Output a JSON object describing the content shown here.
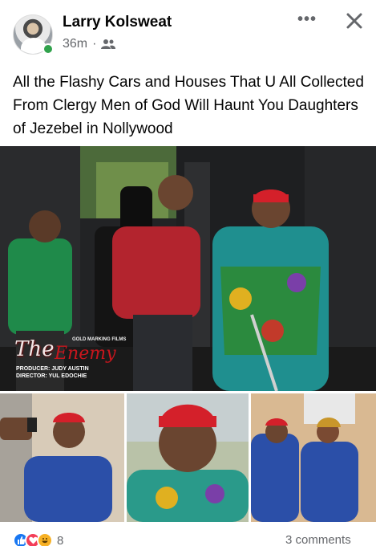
{
  "post": {
    "author": "Larry Kolsweat",
    "time": "36m",
    "separator": "·",
    "privacy_icon": "friends-icon",
    "more_icon": "more-options-icon",
    "more_glyph": "•••",
    "close_icon": "close-icon",
    "text": "All the Flashy Cars and Houses That U All Collected From Clergy Men of God Will Haunt You Daughters of Jezebel in Nollywood"
  },
  "media": {
    "watermark": {
      "title": "The",
      "title_accent": "Enemy",
      "studio": "GOLD MARKING FILMS",
      "producer": "PRODUCER: JUDY AUSTIN",
      "director": "DIRECTOR: YUL EDOCHIE"
    }
  },
  "footer": {
    "reaction_icons": [
      "like-icon",
      "love-icon",
      "haha-icon"
    ],
    "reaction_count": "8",
    "comments": "3 comments"
  },
  "colors": {
    "author_text": "#050505",
    "secondary_text": "#65676b",
    "online_green": "#31a24c",
    "like_blue": "#1877f2",
    "love_red": "#f33e58",
    "haha_yellow": "#f7b125"
  }
}
